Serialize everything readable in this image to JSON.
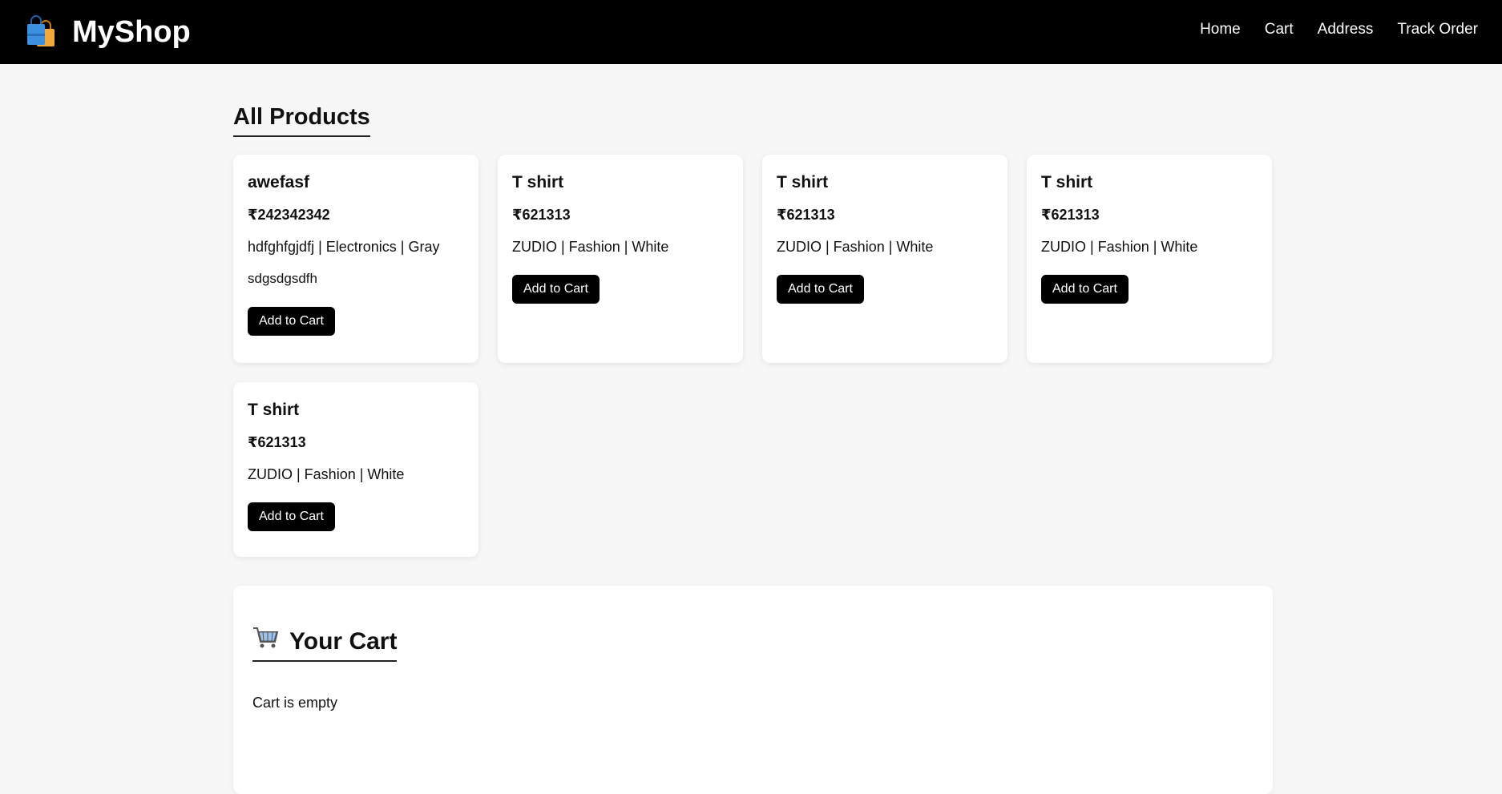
{
  "header": {
    "brand": "MyShop",
    "logo_icon": "shopping-bags-icon",
    "nav": [
      {
        "label": "Home"
      },
      {
        "label": "Cart"
      },
      {
        "label": "Address"
      },
      {
        "label": "Track Order"
      }
    ]
  },
  "products": {
    "title": "All Products",
    "items": [
      {
        "name": "awefasf",
        "price": "₹242342342",
        "meta": "hdfghfgjdfj | Electronics | Gray",
        "description": "sdgsdgsdfh",
        "button": "Add to Cart"
      },
      {
        "name": "T shirt",
        "price": "₹621313",
        "meta": "ZUDIO | Fashion | White",
        "button": "Add to Cart"
      },
      {
        "name": "T shirt",
        "price": "₹621313",
        "meta": "ZUDIO | Fashion | White",
        "button": "Add to Cart"
      },
      {
        "name": "T shirt",
        "price": "₹621313",
        "meta": "ZUDIO | Fashion | White",
        "button": "Add to Cart"
      },
      {
        "name": "T shirt",
        "price": "₹621313",
        "meta": "ZUDIO | Fashion | White",
        "button": "Add to Cart"
      }
    ]
  },
  "cart": {
    "title": "Your Cart",
    "icon": "shopping-cart-icon",
    "empty_text": "Cart is empty"
  }
}
